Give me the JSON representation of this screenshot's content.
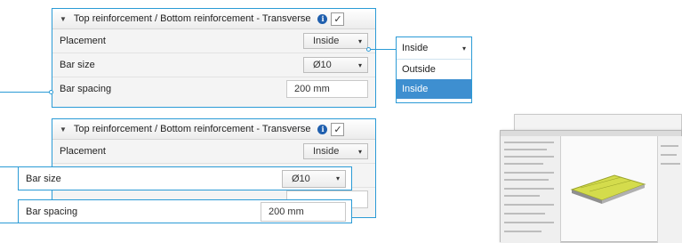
{
  "panel_top": {
    "title": "Top reinforcement / Bottom reinforcement - Transverse",
    "checkbox_mark": "✓",
    "rows": [
      {
        "label": "Placement",
        "value": "Inside"
      },
      {
        "label": "Bar size",
        "value": "Ø10"
      },
      {
        "label": "Bar spacing",
        "value": "200 mm"
      }
    ]
  },
  "dropdown": {
    "selected": "Inside",
    "options": [
      "Outside",
      "Inside"
    ]
  },
  "panel_bottom": {
    "title": "Top reinforcement / Bottom reinforcement - Transverse",
    "checkbox_mark": "✓",
    "rows": [
      {
        "label": "Placement",
        "value": "Inside"
      }
    ]
  },
  "callouts": {
    "bar_size": {
      "label": "Bar size",
      "value": "Ø10"
    },
    "bar_spacing": {
      "label": "Bar spacing",
      "value": "200 mm"
    }
  },
  "icons": {
    "collapse": "▼",
    "caret": "▾",
    "info": "i"
  },
  "colors": {
    "accent": "#2b9bd6",
    "selection": "#3e8fd0",
    "info": "#1f5fae",
    "slab_model": "#d4dc4c"
  }
}
